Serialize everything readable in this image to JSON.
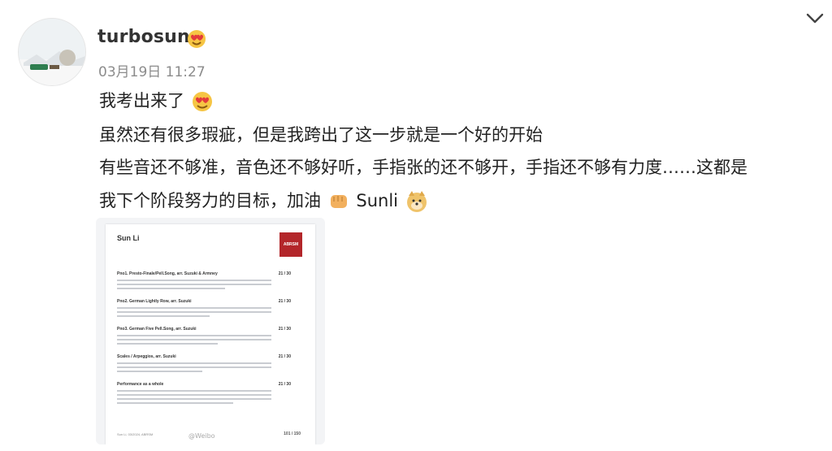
{
  "post": {
    "username": "turbosun",
    "timestamp": "03月19日 11:27",
    "lines": [
      "我考出来了",
      "虽然还有很多瑕疵，但是我跨出了这一步就是一个好的开始",
      "有些音还不够准，音色还不够好听，手指张的还不够开，手指还不够有力度……这都是",
      "我下个阶段努力的目标，加油",
      "Sunli"
    ]
  },
  "icons": {
    "badge": "heart-eyes-face-icon",
    "line1_emoji": "heart-eyes-emoji-icon",
    "line4_emoji1": "fist-emoji-icon",
    "line4_emoji2": "doge-emoji-icon",
    "menu": "chevron-down-icon"
  },
  "document": {
    "name": "Sun Li",
    "crest_text": "ABRSM",
    "rows": [
      {
        "title": "Pno1. Presto-Finale/Pell.Song, arr. Suzuki & Armney",
        "mark": "21 / 30"
      },
      {
        "title": "Pno2. German Lightly Row, arr. Suzuki",
        "mark": "21 / 30"
      },
      {
        "title": "Pno3. German Five Pell.Song, arr. Suzuki",
        "mark": "21 / 30"
      },
      {
        "title": "Scales / Arpeggios, arr. Suzuki",
        "mark": "21 / 30"
      },
      {
        "title": "Performance as a whole",
        "mark": "21 / 30"
      }
    ],
    "footer_left": "Sun Li, 03/2024, ABRSM",
    "footer_total": "101 / 150"
  },
  "watermark": "@Weibo"
}
